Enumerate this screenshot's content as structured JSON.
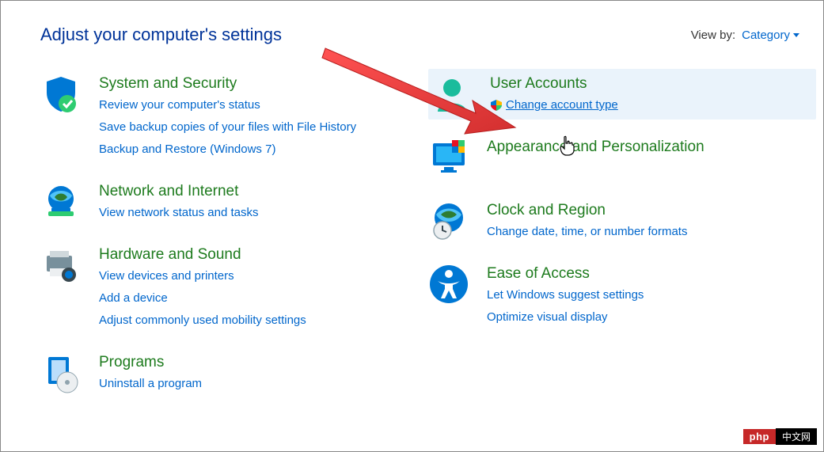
{
  "header": {
    "title": "Adjust your computer's settings",
    "viewby_label": "View by:",
    "viewby_value": "Category"
  },
  "left": [
    {
      "title": "System and Security",
      "links": [
        "Review your computer's status",
        "Save backup copies of your files with File History",
        "Backup and Restore (Windows 7)"
      ]
    },
    {
      "title": "Network and Internet",
      "links": [
        "View network status and tasks"
      ]
    },
    {
      "title": "Hardware and Sound",
      "links": [
        "View devices and printers",
        "Add a device",
        "Adjust commonly used mobility settings"
      ]
    },
    {
      "title": "Programs",
      "links": [
        "Uninstall a program"
      ]
    }
  ],
  "right": [
    {
      "title": "User Accounts",
      "links": [
        "Change account type"
      ],
      "highlight": true,
      "shield": true
    },
    {
      "title": "Appearance and Personalization",
      "links": []
    },
    {
      "title": "Clock and Region",
      "links": [
        "Change date, time, or number formats"
      ]
    },
    {
      "title": "Ease of Access",
      "links": [
        "Let Windows suggest settings",
        "Optimize visual display"
      ]
    }
  ],
  "watermark": {
    "red": "php",
    "black": "中文网"
  }
}
